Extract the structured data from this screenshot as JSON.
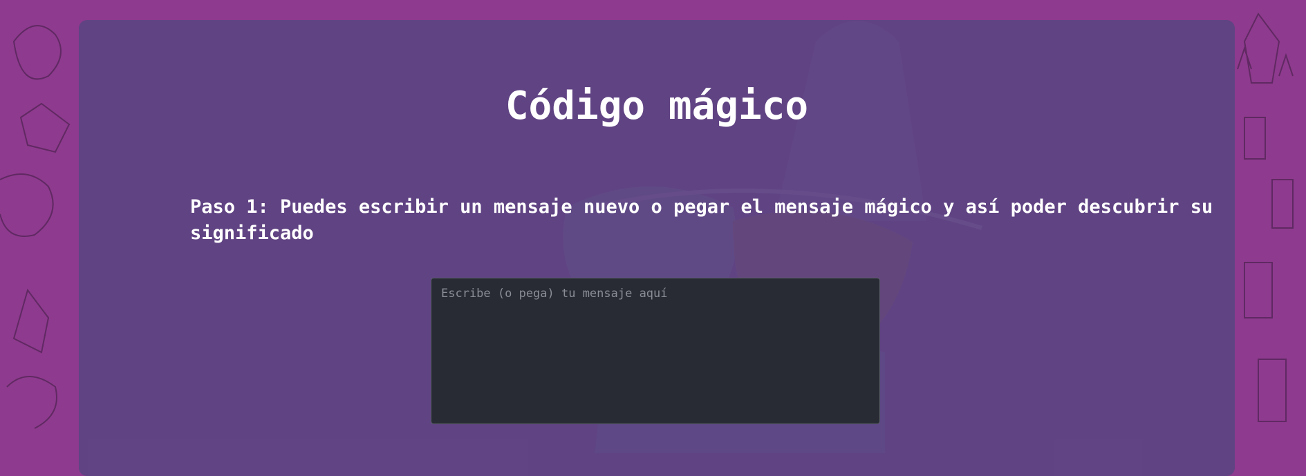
{
  "page": {
    "title": "Código mágico",
    "step1_text": "Paso 1: Puedes escribir un mensaje nuevo o pegar el mensaje mágico y así poder descubrir su significado"
  },
  "message_input": {
    "placeholder": "Escribe (o pega) tu mensaje aquí",
    "value": ""
  },
  "colors": {
    "background": "#8e3a8e",
    "panel": "#564680",
    "textarea_bg": "#282b34",
    "text": "#ffffff"
  }
}
